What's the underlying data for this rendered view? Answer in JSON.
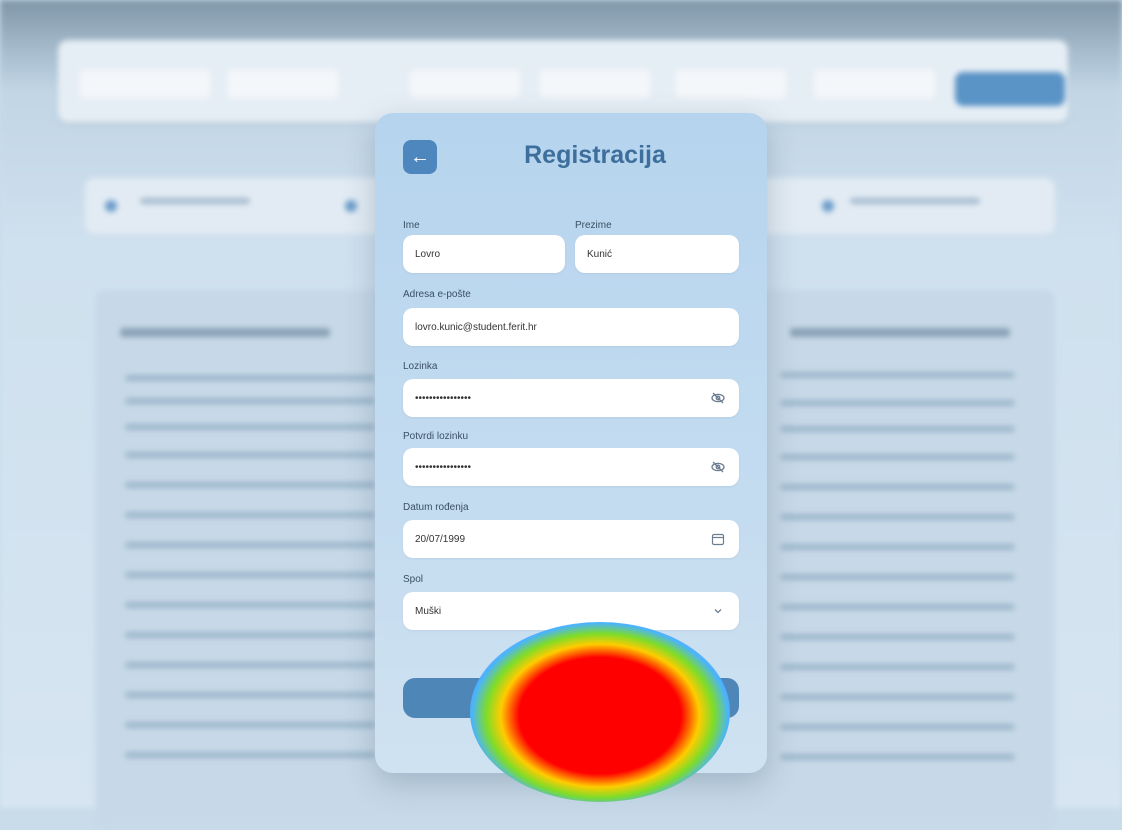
{
  "modal": {
    "title": "Registracija",
    "back_icon": "arrow-left-icon",
    "fields": {
      "ime": {
        "label": "Ime",
        "value": "Lovro"
      },
      "prezime": {
        "label": "Prezime",
        "value": "Kunić"
      },
      "email": {
        "label": "Adresa e-pošte",
        "value": "lovro.kunic@student.ferit.hr"
      },
      "lozinka": {
        "label": "Lozinka",
        "value": "••••••••••••••••",
        "icon": "eye-off-icon"
      },
      "potvrdi": {
        "label": "Potvrdi lozinku",
        "value": "••••••••••••••••",
        "icon": "eye-off-icon"
      },
      "datum": {
        "label": "Datum rođenja",
        "value": "20/07/1999",
        "icon": "calendar-icon"
      },
      "spol": {
        "label": "Spol",
        "value": "Muški",
        "icon": "chevron-down-icon"
      }
    },
    "submit_label": ""
  },
  "colors": {
    "accent": "#4d87be",
    "title": "#3e6f9c",
    "modal_bg": "#c4dcf0"
  }
}
